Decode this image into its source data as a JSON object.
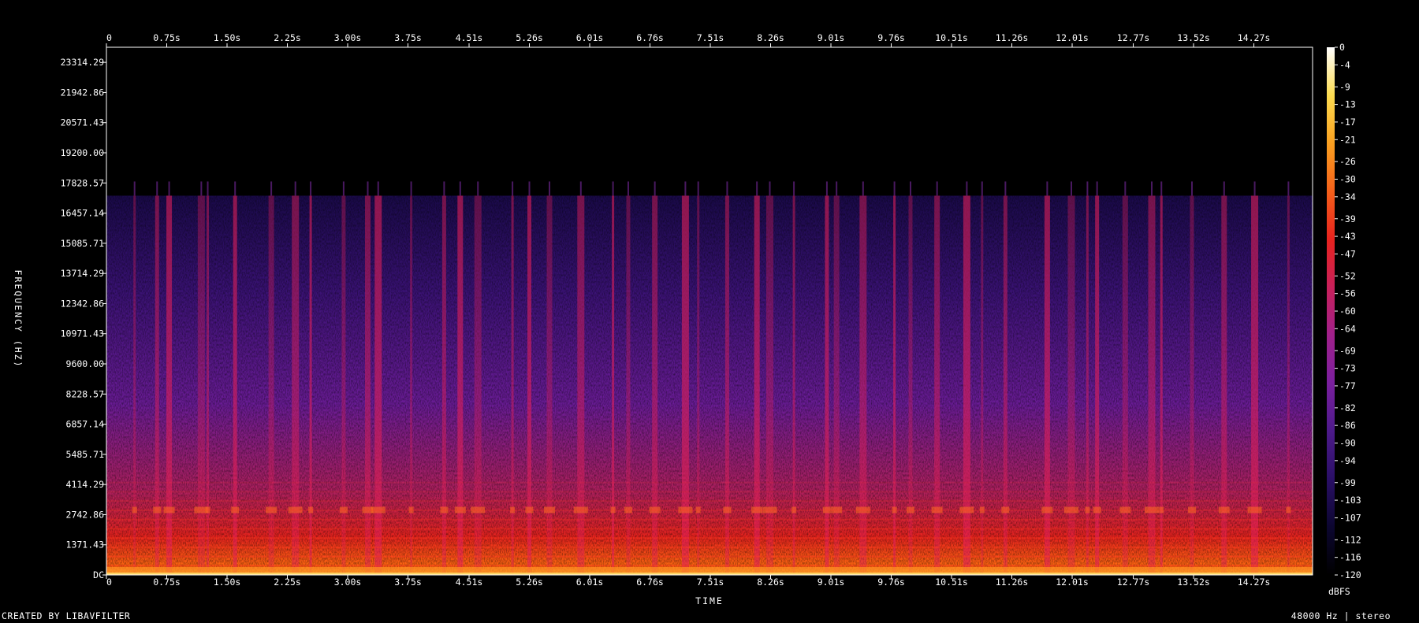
{
  "chart_data": {
    "type": "heatmap",
    "title": "",
    "xlabel": "TIME",
    "ylabel": "FREQUENCY (HZ)",
    "x_tick_labels": [
      "0",
      "0.75s",
      "1.50s",
      "2.25s",
      "3.00s",
      "3.75s",
      "4.51s",
      "5.26s",
      "6.01s",
      "6.76s",
      "7.51s",
      "8.26s",
      "9.01s",
      "9.76s",
      "10.51s",
      "11.26s",
      "12.01s",
      "12.77s",
      "13.52s",
      "14.27s"
    ],
    "x_ticks_seconds": [
      0,
      0.75,
      1.5,
      2.25,
      3.0,
      3.75,
      4.51,
      5.26,
      6.01,
      6.76,
      7.51,
      8.26,
      9.01,
      9.76,
      10.51,
      11.26,
      12.01,
      12.77,
      13.52,
      14.27
    ],
    "xlim_seconds": [
      0,
      15.0
    ],
    "y_tick_labels": [
      "DC",
      "1371.43",
      "2742.86",
      "4114.29",
      "5485.71",
      "6857.14",
      "8228.57",
      "9600.00",
      "10971.43",
      "12342.86",
      "13714.29",
      "15085.71",
      "16457.14",
      "17828.57",
      "19200.00",
      "20571.43",
      "21942.86",
      "23314.29"
    ],
    "ylim_hz": [
      0,
      24000
    ],
    "content_cutoff_hz": 17250,
    "colorbar": {
      "unit": "dBFS",
      "tick_labels": [
        "0",
        "-4",
        "-9",
        "-13",
        "-17",
        "-21",
        "-26",
        "-30",
        "-34",
        "-39",
        "-43",
        "-47",
        "-52",
        "-56",
        "-60",
        "-64",
        "-69",
        "-73",
        "-77",
        "-82",
        "-86",
        "-90",
        "-94",
        "-99",
        "-103",
        "-107",
        "-112",
        "-116",
        "-120"
      ],
      "range_db": [
        -120,
        0
      ],
      "colors": [
        "#000000",
        "#0c0630",
        "#2a0f66",
        "#4d1a8a",
        "#7a1f9e",
        "#a0208a",
        "#c8205a",
        "#e8231e",
        "#f5601a",
        "#faa020",
        "#fddc50",
        "#ffffff"
      ]
    },
    "onsets_seconds": [
      0.35,
      0.63,
      0.78,
      1.18,
      1.26,
      1.6,
      2.05,
      2.35,
      2.54,
      2.95,
      3.25,
      3.38,
      3.79,
      4.2,
      4.4,
      4.62,
      5.05,
      5.26,
      5.51,
      5.9,
      6.3,
      6.49,
      6.82,
      7.2,
      7.36,
      7.72,
      8.09,
      8.25,
      8.55,
      8.96,
      9.08,
      9.41,
      9.8,
      10.0,
      10.33,
      10.7,
      10.89,
      11.18,
      11.7,
      12.0,
      12.2,
      12.32,
      12.67,
      13.0,
      13.12,
      13.5,
      13.9,
      14.28,
      14.7
    ]
  },
  "footer": {
    "created_by": "CREATED BY LIBAVFILTER",
    "info": "48000 Hz | stereo"
  }
}
